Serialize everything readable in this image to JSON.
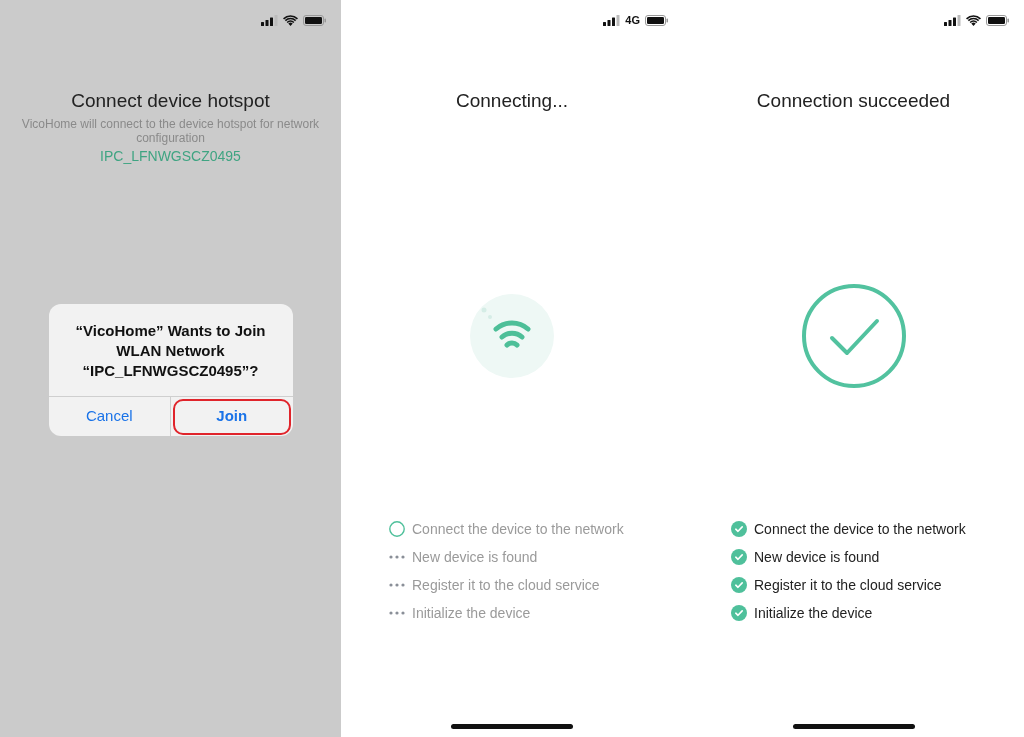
{
  "screens": [
    {
      "status_bar": {
        "kind": "wifi"
      },
      "title": "Connect device hotspot",
      "subtitle": "VicoHome will connect to the device hotspot for network configuration",
      "ssid": "IPC_LFNWGSCZ0495",
      "dialog": {
        "message": "“VicoHome” Wants to Join WLAN Network “IPC_LFNWGSCZ0495”?",
        "buttons": [
          {
            "label": "Cancel",
            "primary": false,
            "circled": false
          },
          {
            "label": "Join",
            "primary": true,
            "circled": true
          }
        ]
      },
      "home_indicator": false
    },
    {
      "status_bar": {
        "kind": "cellular",
        "network_label": "4G"
      },
      "title": "Connecting...",
      "graphic": {
        "kind": "wifi"
      },
      "steps": [
        {
          "label": "Connect the device to the network",
          "kind": "active"
        },
        {
          "label": "New device is found",
          "kind": "pending"
        },
        {
          "label": "Register it to the cloud service",
          "kind": "pending"
        },
        {
          "label": "Initialize the device",
          "kind": "pending"
        }
      ],
      "home_indicator": true
    },
    {
      "status_bar": {
        "kind": "wifi"
      },
      "title": "Connection succeeded",
      "graphic": {
        "kind": "success"
      },
      "steps": [
        {
          "label": "Connect the device to the network",
          "kind": "done"
        },
        {
          "label": "New device is found",
          "kind": "done"
        },
        {
          "label": "Register it to the cloud service",
          "kind": "done"
        },
        {
          "label": "Initialize the device",
          "kind": "done"
        }
      ],
      "home_indicator": true
    }
  ]
}
